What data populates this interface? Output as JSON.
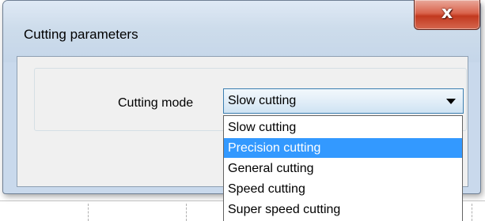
{
  "dialog": {
    "title": "Cutting parameters",
    "close_icon": "close-icon",
    "close_glyph": "x"
  },
  "form": {
    "cutting_mode_label": "Cutting mode",
    "cutting_mode_value": "Slow cutting",
    "dropdown_icon": "chevron-down-icon"
  },
  "dropdown": {
    "highlighted_index": 1,
    "options": [
      "Slow cutting",
      "Precision cutting",
      "General cutting",
      "Speed cutting",
      "Super speed cutting"
    ]
  },
  "colors": {
    "highlight": "#3399ff",
    "close_button": "#c2391f",
    "titlebar": "#cddceb"
  }
}
